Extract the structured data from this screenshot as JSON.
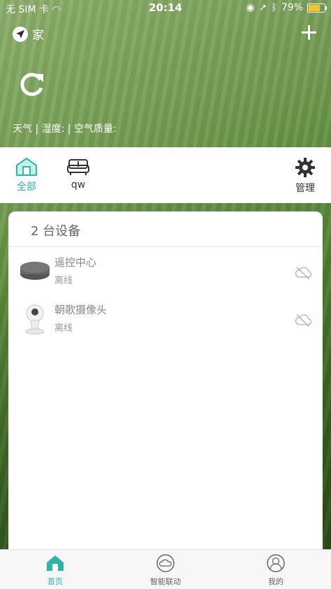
{
  "status_bar": {
    "carrier": "无 SIM 卡",
    "time": "20:14",
    "battery": "79%",
    "battery_level": 0.79
  },
  "header": {
    "home_name": "家",
    "weather_line": "天气 | 湿度: | 空气质量:"
  },
  "rooms": [
    {
      "label": "全部",
      "icon": "home-icon",
      "active": true
    },
    {
      "label": "qw",
      "icon": "sofa-icon",
      "active": false
    }
  ],
  "manage_label": "管理",
  "device_panel": {
    "count_label": "2 台设备",
    "devices": [
      {
        "name": "遥控中心",
        "status": "离线",
        "icon": "remote-hub-icon"
      },
      {
        "name": "朝歌摄像头",
        "status": "离线",
        "icon": "camera-icon"
      }
    ]
  },
  "bottom_nav": [
    {
      "label": "首页",
      "icon": "home-icon",
      "active": true
    },
    {
      "label": "智能联动",
      "icon": "cloud-link-icon",
      "active": false
    },
    {
      "label": "我的",
      "icon": "profile-icon",
      "active": false
    }
  ],
  "colors": {
    "accent": "#2ab5a5"
  }
}
